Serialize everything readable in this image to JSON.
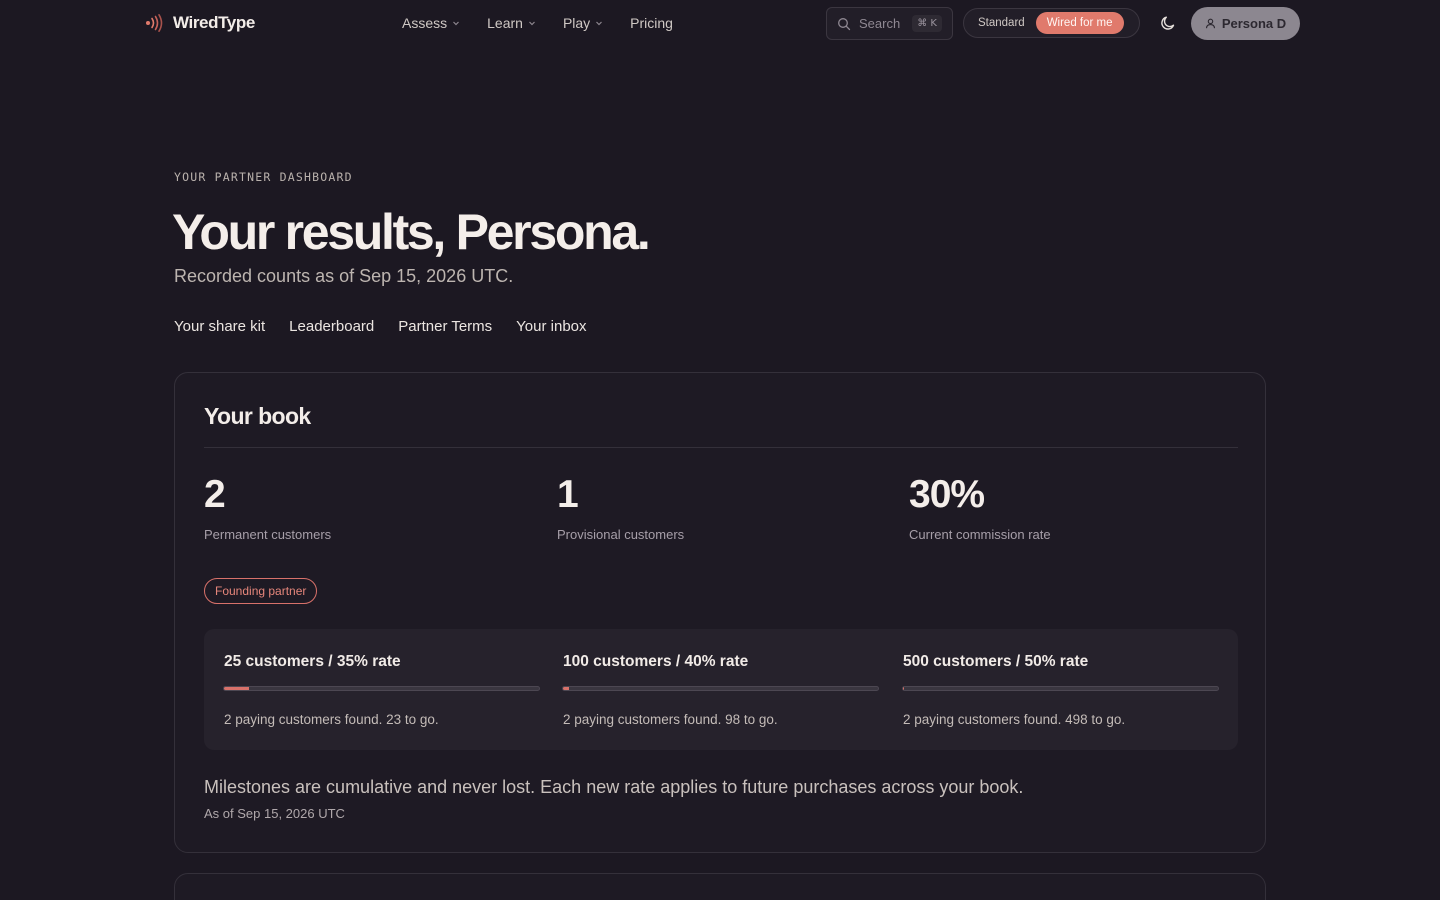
{
  "nav": {
    "logo_text": "WiredType",
    "menu": [
      {
        "label": "Assess",
        "has_dropdown": true
      },
      {
        "label": "Learn",
        "has_dropdown": true
      },
      {
        "label": "Play",
        "has_dropdown": true
      },
      {
        "label": "Pricing",
        "has_dropdown": false
      }
    ],
    "search": {
      "label": "Search",
      "shortcut": "⌘ K"
    },
    "mode_toggle": {
      "options": [
        "Standard",
        "Wired for me"
      ],
      "active": "Wired for me"
    },
    "theme_icon": "moon-icon",
    "user": {
      "label": "Persona D",
      "icon": "user-icon"
    }
  },
  "hero": {
    "eyebrow": "YOUR PARTNER DASHBOARD",
    "title": "Your results, Persona.",
    "subtitle": "Recorded counts as of Sep 15, 2026 UTC."
  },
  "subnav": [
    "Your share kit",
    "Leaderboard",
    "Partner Terms",
    "Your inbox"
  ],
  "book": {
    "title": "Your book",
    "stats": [
      {
        "value": "2",
        "label": "Permanent customers"
      },
      {
        "value": "1",
        "label": "Provisional customers"
      },
      {
        "value": "30%",
        "label": "Current commission rate"
      }
    ],
    "badge": "Founding partner",
    "milestones": [
      {
        "title": "25 customers / 35% rate",
        "progress": 0.08,
        "note": "2 paying customers found. 23 to go."
      },
      {
        "title": "100 customers / 40% rate",
        "progress": 0.02,
        "note": "2 paying customers found. 98 to go."
      },
      {
        "title": "500 customers / 50% rate",
        "progress": 0.004,
        "note": "2 paying customers found. 498 to go."
      }
    ],
    "footnote": "Milestones are cumulative and never lost. Each new rate applies to future purchases across your book.",
    "as_of": "As of Sep 15, 2026 UTC"
  },
  "colors": {
    "background": "#1c1822",
    "accent": "#e07a6c",
    "card": "#1e1a24",
    "milestone_panel": "#26222c"
  }
}
